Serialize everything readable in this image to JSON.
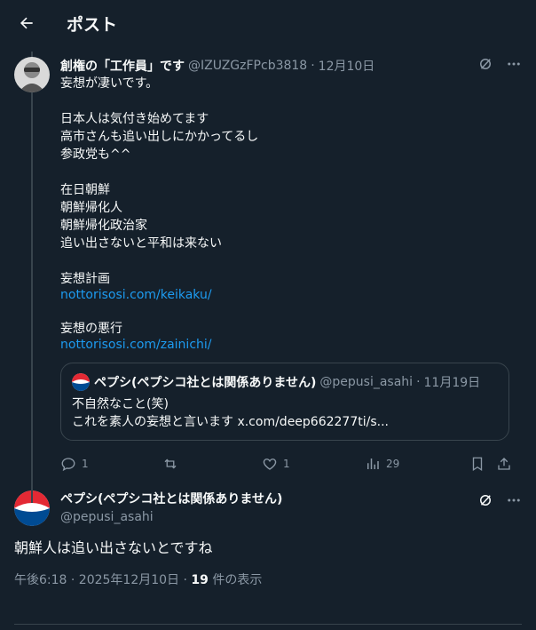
{
  "header": {
    "title": "ポスト"
  },
  "tweet": {
    "author_name": "創権の「工作員」です",
    "handle": "@IZUZGzFPcb3818",
    "dot": "·",
    "date": "12月10日",
    "text_main": "妄想が凄いです。\n\n日本人は気付き始めてます\n高市さんも追い出しにかかってるし\n参政党も^^\n\n在日朝鮮\n朝鮮帰化人\n朝鮮帰化政治家\n追い出さないと平和は来ない\n\n妄想計画",
    "link1": "nottorisosi.com/keikaku/",
    "text_mid": "妄想の悪行",
    "link2": "nottorisosi.com/zainichi/",
    "quote": {
      "author_name": "ペプシ(ペプシコ社とは関係ありません)",
      "handle": "@pepusi_asahi",
      "dot": "·",
      "date": "11月19日",
      "line1": "不自然なこと(笑)",
      "line2": "これを素人の妄想と言います x.com/deep662277ti/s..."
    },
    "actions": {
      "reply_count": "1",
      "retweet_count": "",
      "like_count": "1",
      "views_count": "29"
    }
  },
  "reply": {
    "author_name": "ペプシ(ペプシコ社とは関係ありません)",
    "handle": "@pepusi_asahi",
    "text": "朝鮮人は追い出さないとですね",
    "time": "午後6:18 · 2025年12月10日 · ",
    "views": "19",
    "views_suffix": " 件の表示"
  },
  "colors": {
    "background": "#15202b",
    "accent": "#1d9bf0",
    "muted": "#8b98a5",
    "border": "#38444d"
  }
}
